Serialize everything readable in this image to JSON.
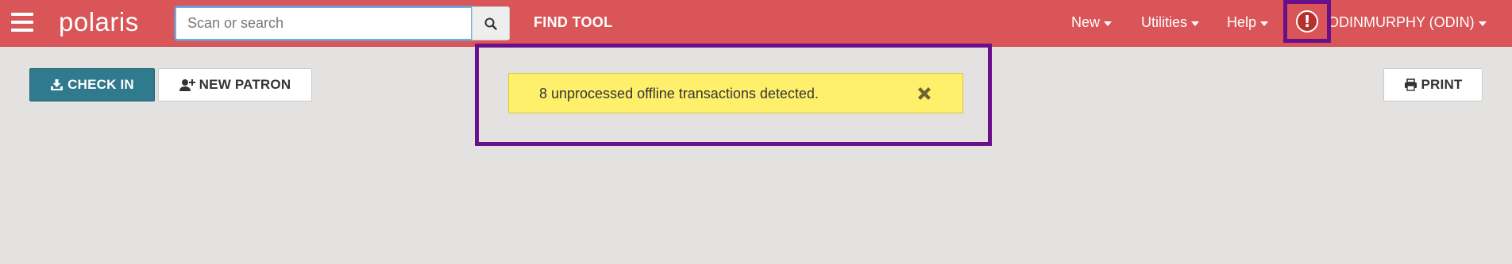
{
  "app": {
    "logo": "polaris"
  },
  "search": {
    "placeholder": "Scan or search"
  },
  "nav": {
    "find_tool": "FIND TOOL",
    "menus": [
      {
        "label": "New"
      },
      {
        "label": "Utilities"
      },
      {
        "label": "Help"
      }
    ],
    "alert_glyph": "!",
    "user": "ODINMURPHY (ODIN)"
  },
  "toolbar": {
    "check_in": "CHECK IN",
    "new_patron": "NEW PATRON",
    "print": "PRINT"
  },
  "notification": {
    "message": "8 unprocessed offline transactions detected."
  },
  "colors": {
    "navbar": "#d95558",
    "check_in": "#2f7a8c",
    "notice": "#fff06c",
    "highlight": "#6a0f8a",
    "alert": "#b7312c"
  },
  "icons": [
    "menu-icon",
    "search-icon",
    "alert-icon",
    "download-icon",
    "user-plus-icon",
    "print-icon",
    "close-icon",
    "caret-down-icon"
  ]
}
